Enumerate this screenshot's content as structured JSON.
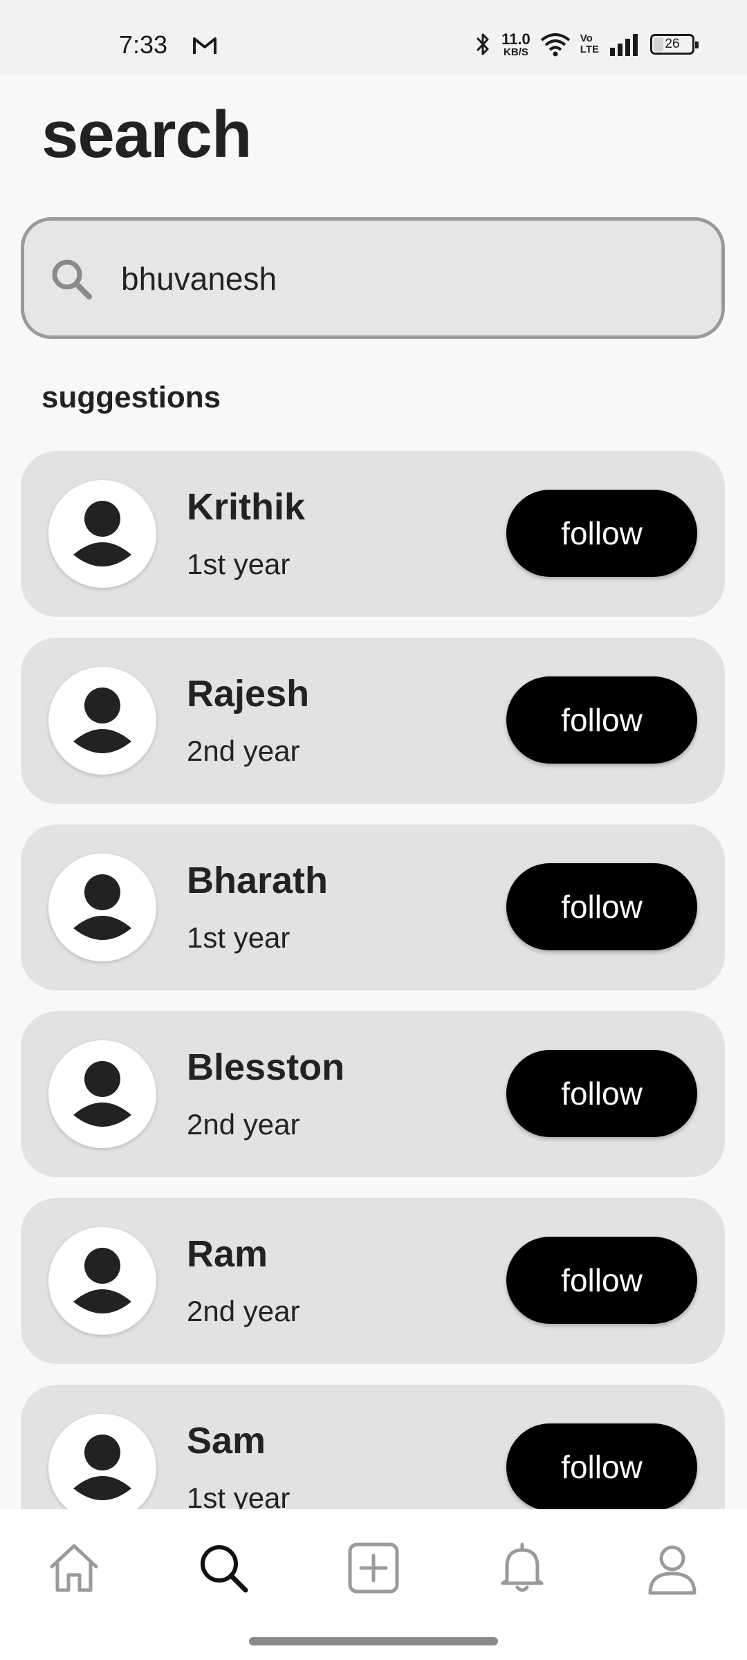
{
  "status_bar": {
    "time": "7:33",
    "net_speed_value": "11.0",
    "net_speed_unit": "KB/S",
    "volte_top": "Vo",
    "volte_bottom": "LTE",
    "battery": "26"
  },
  "header": {
    "title": "search"
  },
  "search": {
    "value": "bhuvanesh",
    "placeholder": ""
  },
  "suggestions": {
    "label": "suggestions",
    "follow_label": "follow",
    "items": [
      {
        "name": "Krithik",
        "year": "1st year"
      },
      {
        "name": "Rajesh",
        "year": "2nd year"
      },
      {
        "name": "Bharath",
        "year": "1st year"
      },
      {
        "name": "Blesston",
        "year": "2nd year"
      },
      {
        "name": "Ram",
        "year": "2nd year"
      },
      {
        "name": "Sam",
        "year": "1st year"
      }
    ]
  },
  "bottom_nav": {
    "items": [
      {
        "icon": "home-icon",
        "active": false
      },
      {
        "icon": "search-icon",
        "active": true
      },
      {
        "icon": "add-icon",
        "active": false
      },
      {
        "icon": "bell-icon",
        "active": false
      },
      {
        "icon": "profile-icon",
        "active": false
      }
    ]
  },
  "colors": {
    "background": "#f8f8f8",
    "card": "#e2e2e2",
    "button": "#000000",
    "button_text": "#ffffff",
    "nav_inactive": "#9a9a9a",
    "nav_active": "#111111"
  }
}
